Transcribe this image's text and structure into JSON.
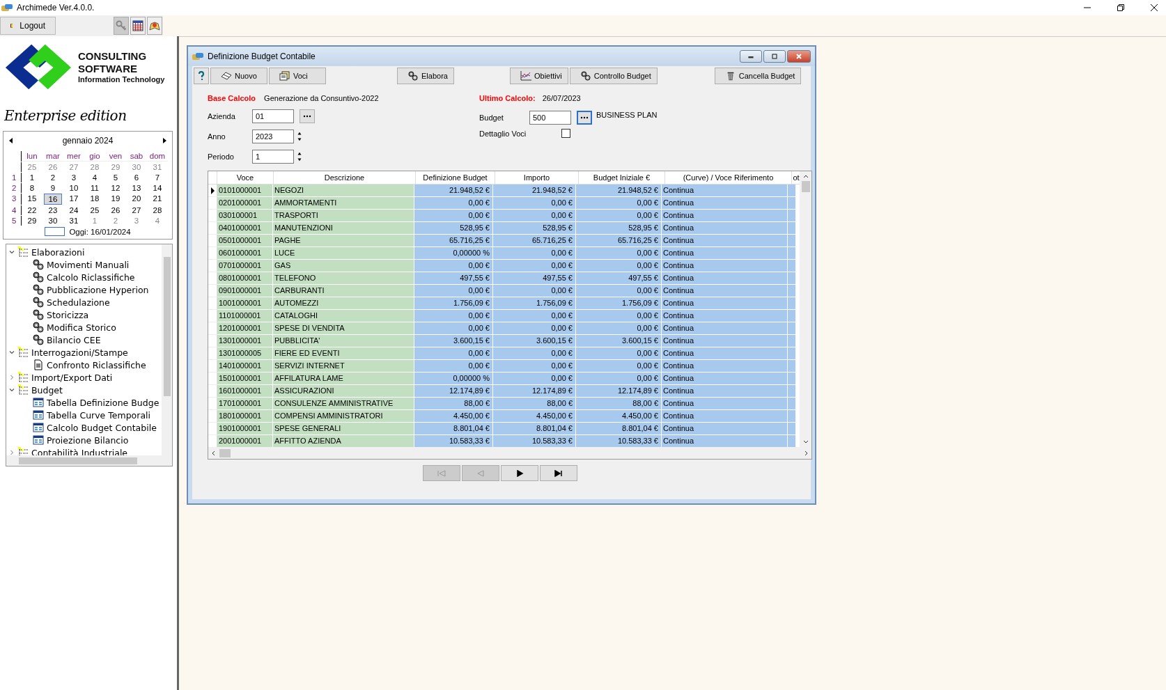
{
  "window": {
    "title": "Archimede Ver.4.0.0."
  },
  "toolbar": {
    "logout": "Logout"
  },
  "logo": {
    "line1": "CONSULTING",
    "line2": "SOFTWARE",
    "line3": "Information Technology",
    "edition": "Enterprise edition"
  },
  "calendar": {
    "month": "gennaio 2024",
    "weekdays": [
      "lun",
      "mar",
      "mer",
      "gio",
      "ven",
      "sab",
      "dom"
    ],
    "weeks": [
      {
        "days": [
          {
            "label": "25",
            "other_month": true,
            "selected": false
          },
          {
            "label": "26",
            "other_month": true,
            "selected": false
          },
          {
            "label": "27",
            "other_month": true,
            "selected": false
          },
          {
            "label": "28",
            "other_month": true,
            "selected": false
          },
          {
            "label": "29",
            "other_month": true,
            "selected": false
          },
          {
            "label": "30",
            "other_month": true,
            "selected": false
          },
          {
            "label": "31",
            "other_month": true,
            "selected": false
          }
        ]
      },
      {
        "number": "1",
        "days": [
          {
            "label": "1",
            "other_month": false,
            "selected": false
          },
          {
            "label": "2",
            "other_month": false,
            "selected": false
          },
          {
            "label": "3",
            "other_month": false,
            "selected": false
          },
          {
            "label": "4",
            "other_month": false,
            "selected": false
          },
          {
            "label": "5",
            "other_month": false,
            "selected": false
          },
          {
            "label": "6",
            "other_month": false,
            "selected": false
          },
          {
            "label": "7",
            "other_month": false,
            "selected": false
          }
        ]
      },
      {
        "number": "2",
        "days": [
          {
            "label": "8",
            "other_month": false,
            "selected": false
          },
          {
            "label": "9",
            "other_month": false,
            "selected": false
          },
          {
            "label": "10",
            "other_month": false,
            "selected": false
          },
          {
            "label": "11",
            "other_month": false,
            "selected": false
          },
          {
            "label": "12",
            "other_month": false,
            "selected": false
          },
          {
            "label": "13",
            "other_month": false,
            "selected": false
          },
          {
            "label": "14",
            "other_month": false,
            "selected": false
          }
        ]
      },
      {
        "number": "3",
        "days": [
          {
            "label": "15",
            "other_month": false,
            "selected": false
          },
          {
            "label": "16",
            "other_month": false,
            "selected": true
          },
          {
            "label": "17",
            "other_month": false,
            "selected": false
          },
          {
            "label": "18",
            "other_month": false,
            "selected": false
          },
          {
            "label": "19",
            "other_month": false,
            "selected": false
          },
          {
            "label": "20",
            "other_month": false,
            "selected": false
          },
          {
            "label": "21",
            "other_month": false,
            "selected": false
          }
        ]
      },
      {
        "number": "4",
        "days": [
          {
            "label": "22",
            "other_month": false,
            "selected": false
          },
          {
            "label": "23",
            "other_month": false,
            "selected": false
          },
          {
            "label": "24",
            "other_month": false,
            "selected": false
          },
          {
            "label": "25",
            "other_month": false,
            "selected": false
          },
          {
            "label": "26",
            "other_month": false,
            "selected": false
          },
          {
            "label": "27",
            "other_month": false,
            "selected": false
          },
          {
            "label": "28",
            "other_month": false,
            "selected": false
          }
        ]
      },
      {
        "number": "5",
        "days": [
          {
            "label": "29",
            "other_month": false,
            "selected": false
          },
          {
            "label": "30",
            "other_month": false,
            "selected": false
          },
          {
            "label": "31",
            "other_month": false,
            "selected": false
          },
          {
            "label": "1",
            "other_month": true,
            "selected": false
          },
          {
            "label": "2",
            "other_month": true,
            "selected": false
          },
          {
            "label": "3",
            "other_month": true,
            "selected": false
          },
          {
            "label": "4",
            "other_month": true,
            "selected": false
          }
        ]
      }
    ],
    "today": "Oggi: 16/01/2024"
  },
  "tree": [
    {
      "label": "Elaborazioni",
      "kind": "folder",
      "expanded": true,
      "children": [
        {
          "label": "Movimenti Manuali",
          "kind": "process"
        },
        {
          "label": "Calcolo Riclassifiche",
          "kind": "process"
        },
        {
          "label": "Pubblicazione Hyperion",
          "kind": "process"
        },
        {
          "label": "Schedulazione",
          "kind": "process"
        },
        {
          "label": "Storicizza",
          "kind": "process"
        },
        {
          "label": "Modifica Storico",
          "kind": "process"
        },
        {
          "label": "Bilancio CEE",
          "kind": "process"
        }
      ]
    },
    {
      "label": "Interrogazioni/Stampe",
      "kind": "folder",
      "expanded": true,
      "children": [
        {
          "label": "Confronto Riclassifiche",
          "kind": "report"
        }
      ]
    },
    {
      "label": "Import/Export Dati",
      "kind": "folder",
      "expanded": false
    },
    {
      "label": "Budget",
      "kind": "folder",
      "expanded": true,
      "children": [
        {
          "label": "Tabella Definizione Budge",
          "kind": "table"
        },
        {
          "label": "Tabella Curve Temporali",
          "kind": "table"
        },
        {
          "label": "Calcolo Budget Contabile",
          "kind": "table"
        },
        {
          "label": "Proiezione Bilancio",
          "kind": "table"
        }
      ]
    },
    {
      "label": "Contabilità Industriale",
      "kind": "folder",
      "expanded": false
    }
  ],
  "dialog": {
    "title": "Definizione Budget Contabile",
    "buttons": [
      {
        "label": "Nuovo",
        "kind": "new"
      },
      {
        "label": "Voci",
        "kind": "items"
      },
      {
        "label": "Elabora",
        "kind": "gears"
      },
      {
        "label": "Obiettivi",
        "kind": "chart"
      },
      {
        "label": "Controllo Budget",
        "kind": "gears"
      },
      {
        "label": "Cancella Budget",
        "kind": "trash"
      }
    ],
    "base_calcolo_label": "Base Calcolo",
    "base_calcolo": "Generazione da Consuntivo-2022",
    "ultimo_calcolo_label": "Ultimo Calcolo:",
    "ultimo_calcolo": "26/07/2023",
    "azienda_label": "Azienda",
    "azienda": "01",
    "anno_label": "Anno",
    "anno": "2023",
    "periodo_label": "Periodo",
    "periodo": "1",
    "budget_label": "Budget",
    "budget": "500",
    "budget_name": "BUSINESS PLAN",
    "dettaglio_label": "Dettaglio Voci",
    "dettaglio_checked": false
  },
  "table": {
    "columns": [
      "Voce",
      "Descrizione",
      "Definizione Budget",
      "Importo",
      "Budget Iniziale €",
      "(Curve) / Voce Riferimento",
      "ot"
    ],
    "rows": [
      {
        "selected": true,
        "cells": [
          "0101000001",
          "NEGOZI",
          "21.948,52 €",
          "21.948,52 €",
          "21.948,52 €",
          "Continua"
        ]
      },
      {
        "selected": false,
        "cells": [
          "0201000001",
          "AMMORTAMENTI",
          "0,00 €",
          "0,00 €",
          "0,00 €",
          "Continua"
        ]
      },
      {
        "selected": false,
        "cells": [
          "030100001",
          "TRASPORTI",
          "0,00 €",
          "0,00 €",
          "0,00 €",
          "Continua"
        ]
      },
      {
        "selected": false,
        "cells": [
          "0401000001",
          "MANUTENZIONI",
          "528,95 €",
          "528,95 €",
          "528,95 €",
          "Continua"
        ]
      },
      {
        "selected": false,
        "cells": [
          "0501000001",
          "PAGHE",
          "65.716,25 €",
          "65.716,25 €",
          "65.716,25 €",
          "Continua"
        ]
      },
      {
        "selected": false,
        "cells": [
          "0601000001",
          "LUCE",
          "0,00000 %",
          "0,00 €",
          "0,00 €",
          "Continua"
        ]
      },
      {
        "selected": false,
        "cells": [
          "0701000001",
          "GAS",
          "0,00 €",
          "0,00 €",
          "0,00 €",
          "Continua"
        ]
      },
      {
        "selected": false,
        "cells": [
          "0801000001",
          "TELEFONO",
          "497,55 €",
          "497,55 €",
          "497,55 €",
          "Continua"
        ]
      },
      {
        "selected": false,
        "cells": [
          "0901000001",
          "CARBURANTI",
          "0,00 €",
          "0,00 €",
          "0,00 €",
          "Continua"
        ]
      },
      {
        "selected": false,
        "cells": [
          "1001000001",
          "AUTOMEZZI",
          "1.756,09 €",
          "1.756,09 €",
          "1.756,09 €",
          "Continua"
        ]
      },
      {
        "selected": false,
        "cells": [
          "1101000001",
          "CATALOGHI",
          "0,00 €",
          "0,00 €",
          "0,00 €",
          "Continua"
        ]
      },
      {
        "selected": false,
        "cells": [
          "1201000001",
          "SPESE DI VENDITA",
          "0,00 €",
          "0,00 €",
          "0,00 €",
          "Continua"
        ]
      },
      {
        "selected": false,
        "cells": [
          "1301000001",
          "PUBBLICITA'",
          "3.600,15 €",
          "3.600,15 €",
          "3.600,15 €",
          "Continua"
        ]
      },
      {
        "selected": false,
        "cells": [
          "1301000005",
          "FIERE ED EVENTI",
          "0,00 €",
          "0,00 €",
          "0,00 €",
          "Continua"
        ]
      },
      {
        "selected": false,
        "cells": [
          "1401000001",
          "SERVIZI INTERNET",
          "0,00 €",
          "0,00 €",
          "0,00 €",
          "Continua"
        ]
      },
      {
        "selected": false,
        "cells": [
          "1501000001",
          "AFFILATURA LAME",
          "0,00000 %",
          "0,00 €",
          "0,00 €",
          "Continua"
        ]
      },
      {
        "selected": false,
        "cells": [
          "1601000001",
          "ASSICURAZIONI",
          "12.174,89 €",
          "12.174,89 €",
          "12.174,89 €",
          "Continua"
        ]
      },
      {
        "selected": false,
        "cells": [
          "1701000001",
          "CONSULENZE AMMINISTRATIVE",
          "88,00 €",
          "88,00 €",
          "88,00 €",
          "Continua"
        ]
      },
      {
        "selected": false,
        "cells": [
          "1801000001",
          "COMPENSI AMMINISTRATORI",
          "4.450,00 €",
          "4.450,00 €",
          "4.450,00 €",
          "Continua"
        ]
      },
      {
        "selected": false,
        "cells": [
          "1901000001",
          "SPESE GENERALI",
          "8.801,04 €",
          "8.801,04 €",
          "8.801,04 €",
          "Continua"
        ]
      },
      {
        "selected": false,
        "cells": [
          "2001000001",
          "AFFITTO AZIENDA",
          "10.583,33 €",
          "10.583,33 €",
          "10.583,33 €",
          "Continua"
        ]
      }
    ]
  },
  "navigator": [
    {
      "kind": "first",
      "disabled": true
    },
    {
      "kind": "prev",
      "disabled": true
    },
    {
      "kind": "next",
      "disabled": false
    },
    {
      "kind": "last",
      "disabled": false
    }
  ]
}
